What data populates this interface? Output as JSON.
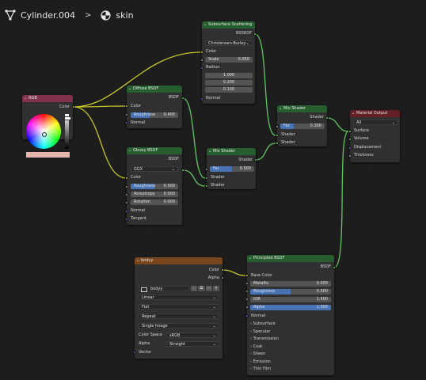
{
  "breadcrumb": {
    "object": "Cylinder.004",
    "material": "skin"
  },
  "colors": {
    "background": "#1d1d1d",
    "node_body": "#303030",
    "header_shader": "#275e2f",
    "header_input": "#83314a",
    "header_texture": "#79461d",
    "header_output": "#631f25",
    "wire_color": "#c7c729",
    "wire_shader": "#63c763",
    "field_blue": "#4772b3"
  },
  "nodes": {
    "rgb": {
      "title": "RGB",
      "out_color": "Color"
    },
    "diffuse": {
      "title": "Diffuse BSDF",
      "out": "BSDF",
      "in_color": "Color",
      "roughness": {
        "label": "Roughness",
        "value": "0.400",
        "fraction": 0.4
      },
      "in_normal": "Normal"
    },
    "glossy": {
      "title": "Glossy BSDF",
      "out": "BSDF",
      "distribution": "GGX",
      "in_color": "Color",
      "roughness": {
        "label": "Roughness",
        "value": "0.500",
        "fraction": 0.5
      },
      "anisotropy": {
        "label": "Anisotropy",
        "value": "0.000"
      },
      "rotation": {
        "label": "Rotation",
        "value": "0.000"
      },
      "in_normal": "Normal",
      "in_tangent": "Tangent"
    },
    "sss": {
      "title": "Subsurface Scattering",
      "out": "BSSRDF",
      "method": "Christensen-Burley",
      "in_color": "Color",
      "scale": {
        "label": "Scale",
        "value": "0.050"
      },
      "radius_label": "Radius:",
      "radius": [
        "1.000",
        "0.200",
        "0.100"
      ],
      "in_normal": "Normal"
    },
    "mix1": {
      "title": "Mix Shader",
      "out": "Shader",
      "fac": {
        "label": "Fac",
        "value": "0.500",
        "fraction": 0.5
      },
      "in_shader1": "Shader",
      "in_shader2": "Shader"
    },
    "mix2": {
      "title": "Mix Shader",
      "out": "Shader",
      "fac": {
        "label": "Fac",
        "value": "0.300",
        "fraction": 0.3
      },
      "in_shader1": "Shader",
      "in_shader2": "Shader"
    },
    "output": {
      "title": "Material Output",
      "target": "All",
      "inputs": [
        "Surface",
        "Volume",
        "Displacement",
        "Thickness"
      ]
    },
    "image": {
      "title": "bodyy",
      "out_color": "Color",
      "out_alpha": "Alpha",
      "image_name": "bodyy",
      "interpolation": "Linear",
      "projection": "Flat",
      "extension": "Repeat",
      "source": "Single Image",
      "color_space_label": "Color Space",
      "color_space": "sRGB",
      "alpha_label": "Alpha",
      "alpha_mode": "Straight",
      "in_vector": "Vector"
    },
    "principled": {
      "title": "Principled BSDF",
      "out": "BSDF",
      "in_base_color": "Base Color",
      "metallic": {
        "label": "Metallic",
        "value": "0.000",
        "fraction": 0
      },
      "roughness": {
        "label": "Roughness",
        "value": "0.500",
        "fraction": 0.5
      },
      "ior": {
        "label": "IOR",
        "value": "1.500"
      },
      "alpha": {
        "label": "Alpha",
        "value": "1.000",
        "fraction": 1
      },
      "in_normal": "Normal",
      "panels": [
        "Subsurface",
        "Specular",
        "Transmission",
        "Coat",
        "Sheen",
        "Emission",
        "Thin Film"
      ]
    }
  }
}
